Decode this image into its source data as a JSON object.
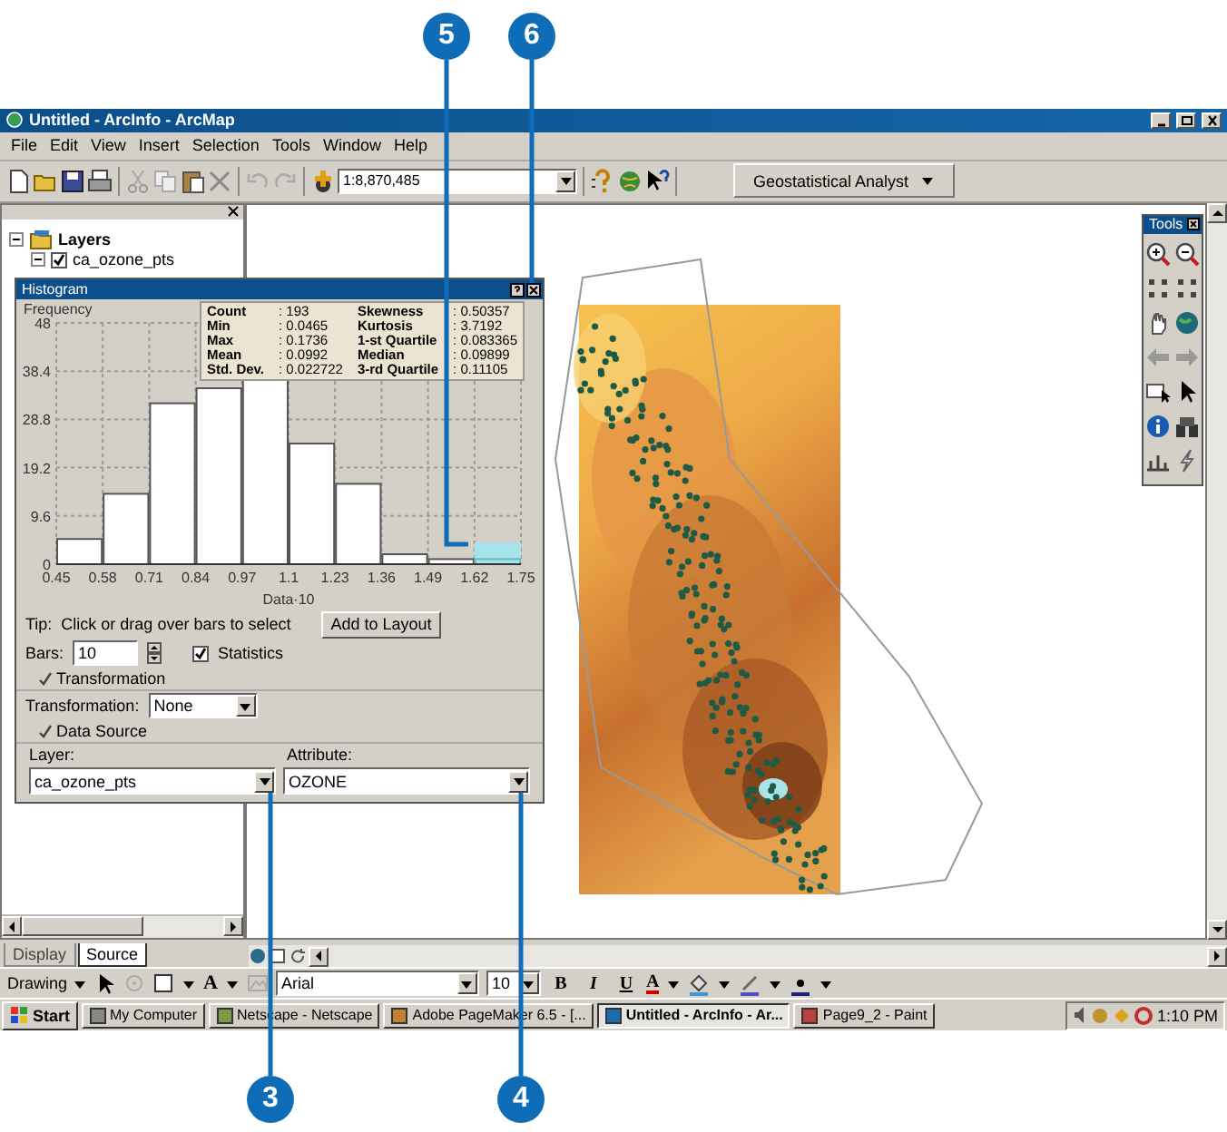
{
  "window": {
    "title": "Untitled - ArcInfo - ArcMap"
  },
  "menu": [
    "File",
    "Edit",
    "View",
    "Insert",
    "Selection",
    "Tools",
    "Window",
    "Help"
  ],
  "toolbar": {
    "scale": "1:8,870,485",
    "geostat_menu": "Geostatistical Analyst"
  },
  "toc": {
    "root": {
      "label": "Layers",
      "expanded": true
    },
    "layers": [
      {
        "name": "ca_ozone_pts",
        "checked": true,
        "expanded": true
      }
    ],
    "tabs": [
      {
        "label": "Display",
        "selected": false
      },
      {
        "label": "Source",
        "selected": true
      }
    ]
  },
  "histogram": {
    "title": "Histogram",
    "chart_data": {
      "type": "bar",
      "ylabel": "Frequency",
      "xlabel": "Data·10",
      "grid": true,
      "x": [
        0.515,
        0.645,
        0.775,
        0.905,
        1.035,
        1.165,
        1.295,
        1.425,
        1.555,
        1.685
      ],
      "values": [
        5,
        14,
        32,
        35,
        37,
        24,
        16,
        2,
        1,
        1
      ],
      "xlim": [
        0.45,
        1.75
      ],
      "ylim": [
        0,
        48
      ],
      "xticks": [
        0.45,
        0.58,
        0.71,
        0.84,
        0.97,
        1.1,
        1.23,
        1.36,
        1.49,
        1.62,
        1.75
      ],
      "yticks": [
        0,
        9.6,
        19.2,
        28.8,
        38.4,
        48
      ]
    },
    "bars": [
      {
        "selected": false
      },
      {
        "selected": false
      },
      {
        "selected": false
      },
      {
        "selected": false
      },
      {
        "selected": false
      },
      {
        "selected": false
      },
      {
        "selected": false
      },
      {
        "selected": false
      },
      {
        "selected": false
      },
      {
        "selected": true
      }
    ],
    "stats": [
      {
        "label": "Count",
        "value": ": 193",
        "label_2": "Skewness",
        "value_2": ": 0.50357"
      },
      {
        "label": "Min",
        "value": ": 0.0465",
        "label_2": "Kurtosis",
        "value_2": ": 3.7192"
      },
      {
        "label": "Max",
        "value": ": 0.1736",
        "label_2": "1-st Quartile",
        "value_2": ": 0.083365"
      },
      {
        "label": "Mean",
        "value": ": 0.0992",
        "label_2": "Median",
        "value_2": ": 0.09899"
      },
      {
        "label": "Std. Dev.",
        "value": ": 0.022722",
        "label_2": "3-rd Quartile",
        "value_2": ": 0.11105"
      }
    ],
    "tip_label": "Tip:",
    "tip": "Click or drag over bars to select",
    "add_button": "Add to Layout",
    "bars_label": "Bars:",
    "bars_value": "10",
    "statistics": {
      "label": "Statistics",
      "checked": true
    },
    "transformation_group": {
      "label": "Transformation",
      "expanded": true
    },
    "transformation_label": "Transformation:",
    "transformation_value": "None",
    "source_group": {
      "label": "Data Source",
      "expanded": true
    },
    "layer_label": "Layer:",
    "layer_value": "ca_ozone_pts",
    "attribute_label": "Attribute:",
    "attribute_value": "OZONE"
  },
  "tools_palette": {
    "title": "Tools"
  },
  "drawing_toolbar": {
    "label": "Drawing",
    "text_tool": "A",
    "font": "Arial",
    "size": "10",
    "format_buttons": [
      "B",
      "I",
      "U"
    ],
    "font_color": "A"
  },
  "taskbar": {
    "start": "Start",
    "tasks": [
      {
        "label": "My Computer",
        "selected": false
      },
      {
        "label": "Netscape - Netscape",
        "selected": false
      },
      {
        "label": "Adobe PageMaker 6.5 - [...",
        "selected": false
      },
      {
        "label": "Untitled - ArcInfo - Ar...",
        "selected": true
      },
      {
        "label": "Page9_2 - Paint",
        "selected": false
      }
    ],
    "clock": "1:10 PM"
  },
  "callouts": [
    {
      "number": "5"
    },
    {
      "number": "6"
    },
    {
      "number": "3"
    },
    {
      "number": "4"
    }
  ]
}
